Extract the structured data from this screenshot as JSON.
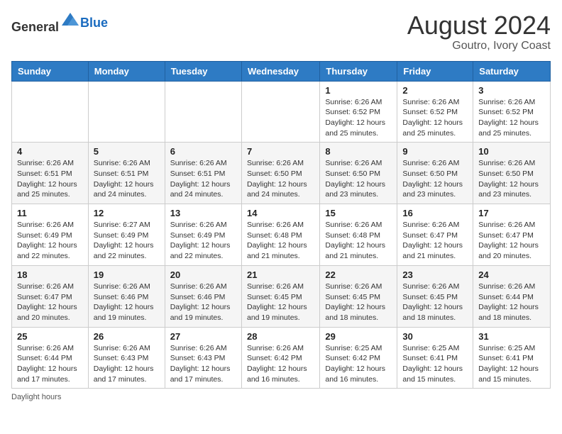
{
  "header": {
    "logo_general": "General",
    "logo_blue": "Blue",
    "month_year": "August 2024",
    "location": "Goutro, Ivory Coast"
  },
  "days_of_week": [
    "Sunday",
    "Monday",
    "Tuesday",
    "Wednesday",
    "Thursday",
    "Friday",
    "Saturday"
  ],
  "footer": {
    "note": "Daylight hours"
  },
  "weeks": [
    [
      {
        "day": "",
        "info": ""
      },
      {
        "day": "",
        "info": ""
      },
      {
        "day": "",
        "info": ""
      },
      {
        "day": "",
        "info": ""
      },
      {
        "day": "1",
        "info": "Sunrise: 6:26 AM\nSunset: 6:52 PM\nDaylight: 12 hours\nand 25 minutes."
      },
      {
        "day": "2",
        "info": "Sunrise: 6:26 AM\nSunset: 6:52 PM\nDaylight: 12 hours\nand 25 minutes."
      },
      {
        "day": "3",
        "info": "Sunrise: 6:26 AM\nSunset: 6:52 PM\nDaylight: 12 hours\nand 25 minutes."
      }
    ],
    [
      {
        "day": "4",
        "info": "Sunrise: 6:26 AM\nSunset: 6:51 PM\nDaylight: 12 hours\nand 25 minutes."
      },
      {
        "day": "5",
        "info": "Sunrise: 6:26 AM\nSunset: 6:51 PM\nDaylight: 12 hours\nand 24 minutes."
      },
      {
        "day": "6",
        "info": "Sunrise: 6:26 AM\nSunset: 6:51 PM\nDaylight: 12 hours\nand 24 minutes."
      },
      {
        "day": "7",
        "info": "Sunrise: 6:26 AM\nSunset: 6:50 PM\nDaylight: 12 hours\nand 24 minutes."
      },
      {
        "day": "8",
        "info": "Sunrise: 6:26 AM\nSunset: 6:50 PM\nDaylight: 12 hours\nand 23 minutes."
      },
      {
        "day": "9",
        "info": "Sunrise: 6:26 AM\nSunset: 6:50 PM\nDaylight: 12 hours\nand 23 minutes."
      },
      {
        "day": "10",
        "info": "Sunrise: 6:26 AM\nSunset: 6:50 PM\nDaylight: 12 hours\nand 23 minutes."
      }
    ],
    [
      {
        "day": "11",
        "info": "Sunrise: 6:26 AM\nSunset: 6:49 PM\nDaylight: 12 hours\nand 22 minutes."
      },
      {
        "day": "12",
        "info": "Sunrise: 6:27 AM\nSunset: 6:49 PM\nDaylight: 12 hours\nand 22 minutes."
      },
      {
        "day": "13",
        "info": "Sunrise: 6:26 AM\nSunset: 6:49 PM\nDaylight: 12 hours\nand 22 minutes."
      },
      {
        "day": "14",
        "info": "Sunrise: 6:26 AM\nSunset: 6:48 PM\nDaylight: 12 hours\nand 21 minutes."
      },
      {
        "day": "15",
        "info": "Sunrise: 6:26 AM\nSunset: 6:48 PM\nDaylight: 12 hours\nand 21 minutes."
      },
      {
        "day": "16",
        "info": "Sunrise: 6:26 AM\nSunset: 6:47 PM\nDaylight: 12 hours\nand 21 minutes."
      },
      {
        "day": "17",
        "info": "Sunrise: 6:26 AM\nSunset: 6:47 PM\nDaylight: 12 hours\nand 20 minutes."
      }
    ],
    [
      {
        "day": "18",
        "info": "Sunrise: 6:26 AM\nSunset: 6:47 PM\nDaylight: 12 hours\nand 20 minutes."
      },
      {
        "day": "19",
        "info": "Sunrise: 6:26 AM\nSunset: 6:46 PM\nDaylight: 12 hours\nand 19 minutes."
      },
      {
        "day": "20",
        "info": "Sunrise: 6:26 AM\nSunset: 6:46 PM\nDaylight: 12 hours\nand 19 minutes."
      },
      {
        "day": "21",
        "info": "Sunrise: 6:26 AM\nSunset: 6:45 PM\nDaylight: 12 hours\nand 19 minutes."
      },
      {
        "day": "22",
        "info": "Sunrise: 6:26 AM\nSunset: 6:45 PM\nDaylight: 12 hours\nand 18 minutes."
      },
      {
        "day": "23",
        "info": "Sunrise: 6:26 AM\nSunset: 6:45 PM\nDaylight: 12 hours\nand 18 minutes."
      },
      {
        "day": "24",
        "info": "Sunrise: 6:26 AM\nSunset: 6:44 PM\nDaylight: 12 hours\nand 18 minutes."
      }
    ],
    [
      {
        "day": "25",
        "info": "Sunrise: 6:26 AM\nSunset: 6:44 PM\nDaylight: 12 hours\nand 17 minutes."
      },
      {
        "day": "26",
        "info": "Sunrise: 6:26 AM\nSunset: 6:43 PM\nDaylight: 12 hours\nand 17 minutes."
      },
      {
        "day": "27",
        "info": "Sunrise: 6:26 AM\nSunset: 6:43 PM\nDaylight: 12 hours\nand 17 minutes."
      },
      {
        "day": "28",
        "info": "Sunrise: 6:26 AM\nSunset: 6:42 PM\nDaylight: 12 hours\nand 16 minutes."
      },
      {
        "day": "29",
        "info": "Sunrise: 6:25 AM\nSunset: 6:42 PM\nDaylight: 12 hours\nand 16 minutes."
      },
      {
        "day": "30",
        "info": "Sunrise: 6:25 AM\nSunset: 6:41 PM\nDaylight: 12 hours\nand 15 minutes."
      },
      {
        "day": "31",
        "info": "Sunrise: 6:25 AM\nSunset: 6:41 PM\nDaylight: 12 hours\nand 15 minutes."
      }
    ]
  ]
}
